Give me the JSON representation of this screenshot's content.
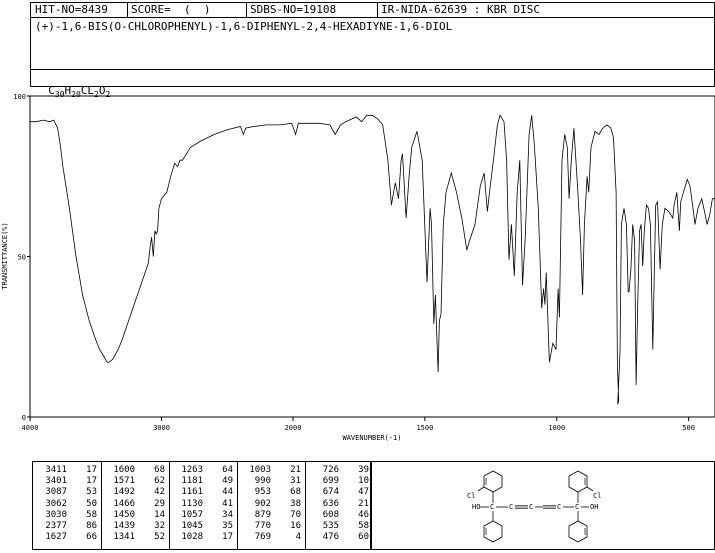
{
  "header": {
    "hit": "HIT-NO=8439",
    "score": "SCORE=  (  )",
    "sdbs": "SDBS-NO=19108",
    "ir": "IR-NIDA-62639 : KBR DISC",
    "compound": "(+)-1,6-BIS(O-CHLOROPHENYL)-1,6-DIPHENYL-2,4-HEXADIYNE-1,6-DIOL",
    "formula_parts": [
      "C",
      "30",
      "H",
      "20",
      "CL",
      "2",
      "O",
      "2"
    ]
  },
  "chart_data": {
    "type": "line",
    "xlabel": "WAVENUMBER(-1)",
    "ylabel": "TRANSMITTANCE(%)",
    "xlim": [
      4000,
      400
    ],
    "ylim": [
      0,
      100
    ],
    "x_ticks": [
      4000,
      3000,
      2000,
      1500,
      1000,
      500
    ],
    "y_ticks": [
      0,
      50,
      100
    ],
    "grid": false,
    "series": [
      {
        "points": [
          [
            4000,
            92
          ],
          [
            3950,
            92
          ],
          [
            3900,
            92.5
          ],
          [
            3850,
            92
          ],
          [
            3820,
            92.5
          ],
          [
            3790,
            90
          ],
          [
            3770,
            85
          ],
          [
            3750,
            78
          ],
          [
            3700,
            65
          ],
          [
            3650,
            50
          ],
          [
            3600,
            38
          ],
          [
            3550,
            30
          ],
          [
            3500,
            24
          ],
          [
            3470,
            21
          ],
          [
            3440,
            19
          ],
          [
            3420,
            17.5
          ],
          [
            3411,
            17
          ],
          [
            3401,
            17
          ],
          [
            3370,
            18
          ],
          [
            3330,
            21
          ],
          [
            3300,
            24
          ],
          [
            3250,
            30
          ],
          [
            3200,
            36
          ],
          [
            3150,
            42
          ],
          [
            3100,
            48
          ],
          [
            3087,
            53
          ],
          [
            3075,
            56
          ],
          [
            3062,
            50
          ],
          [
            3050,
            58
          ],
          [
            3040,
            57
          ],
          [
            3030,
            58
          ],
          [
            3020,
            65
          ],
          [
            3000,
            68
          ],
          [
            2960,
            70
          ],
          [
            2930,
            75
          ],
          [
            2900,
            79
          ],
          [
            2877,
            78
          ],
          [
            2860,
            80
          ],
          [
            2840,
            80
          ],
          [
            2810,
            82
          ],
          [
            2780,
            84
          ],
          [
            2700,
            86
          ],
          [
            2600,
            88
          ],
          [
            2500,
            89.5
          ],
          [
            2400,
            90.5
          ],
          [
            2377,
            88
          ],
          [
            2360,
            90
          ],
          [
            2300,
            90.5
          ],
          [
            2200,
            91
          ],
          [
            2100,
            91
          ],
          [
            2010,
            91.5
          ],
          [
            1990,
            88
          ],
          [
            1980,
            91.5
          ],
          [
            1900,
            91.5
          ],
          [
            1860,
            91
          ],
          [
            1840,
            88
          ],
          [
            1820,
            91
          ],
          [
            1800,
            92
          ],
          [
            1760,
            93.5
          ],
          [
            1740,
            92
          ],
          [
            1720,
            94
          ],
          [
            1700,
            94
          ],
          [
            1680,
            93
          ],
          [
            1660,
            91
          ],
          [
            1640,
            80
          ],
          [
            1627,
            66
          ],
          [
            1612,
            73
          ],
          [
            1600,
            68
          ],
          [
            1590,
            80
          ],
          [
            1585,
            82
          ],
          [
            1571,
            62
          ],
          [
            1560,
            75
          ],
          [
            1550,
            84
          ],
          [
            1530,
            89
          ],
          [
            1510,
            80
          ],
          [
            1492,
            42
          ],
          [
            1480,
            65
          ],
          [
            1475,
            60
          ],
          [
            1466,
            29
          ],
          [
            1460,
            38
          ],
          [
            1450,
            14
          ],
          [
            1445,
            30
          ],
          [
            1439,
            32
          ],
          [
            1430,
            60
          ],
          [
            1420,
            70
          ],
          [
            1400,
            76
          ],
          [
            1380,
            70
          ],
          [
            1360,
            62
          ],
          [
            1341,
            52
          ],
          [
            1330,
            55
          ],
          [
            1310,
            60
          ],
          [
            1290,
            72
          ],
          [
            1275,
            76
          ],
          [
            1263,
            64
          ],
          [
            1255,
            70
          ],
          [
            1240,
            80
          ],
          [
            1225,
            91
          ],
          [
            1215,
            94
          ],
          [
            1200,
            92
          ],
          [
            1190,
            80
          ],
          [
            1181,
            49
          ],
          [
            1172,
            60
          ],
          [
            1161,
            44
          ],
          [
            1150,
            70
          ],
          [
            1140,
            80
          ],
          [
            1130,
            41
          ],
          [
            1120,
            55
          ],
          [
            1105,
            88
          ],
          [
            1095,
            94
          ],
          [
            1085,
            85
          ],
          [
            1070,
            65
          ],
          [
            1057,
            34
          ],
          [
            1050,
            40
          ],
          [
            1045,
            35
          ],
          [
            1040,
            45
          ],
          [
            1028,
            17
          ],
          [
            1015,
            23
          ],
          [
            1003,
            21
          ],
          [
            995,
            40
          ],
          [
            990,
            31
          ],
          [
            980,
            80
          ],
          [
            970,
            88
          ],
          [
            960,
            84
          ],
          [
            953,
            68
          ],
          [
            945,
            80
          ],
          [
            935,
            90
          ],
          [
            920,
            70
          ],
          [
            910,
            55
          ],
          [
            902,
            38
          ],
          [
            895,
            60
          ],
          [
            885,
            75
          ],
          [
            879,
            70
          ],
          [
            870,
            84
          ],
          [
            855,
            89
          ],
          [
            840,
            88
          ],
          [
            825,
            90
          ],
          [
            810,
            91
          ],
          [
            795,
            90
          ],
          [
            785,
            87
          ],
          [
            775,
            70
          ],
          [
            770,
            16
          ],
          [
            765,
            5
          ],
          [
            769,
            4
          ],
          [
            760,
            20
          ],
          [
            755,
            60
          ],
          [
            745,
            65
          ],
          [
            736,
            60
          ],
          [
            729,
            39
          ],
          [
            726,
            39
          ],
          [
            719,
            46
          ],
          [
            712,
            60
          ],
          [
            705,
            55
          ],
          [
            699,
            10
          ],
          [
            693,
            35
          ],
          [
            686,
            58
          ],
          [
            680,
            60
          ],
          [
            674,
            47
          ],
          [
            668,
            58
          ],
          [
            660,
            66
          ],
          [
            652,
            65
          ],
          [
            645,
            60
          ],
          [
            636,
            21
          ],
          [
            630,
            45
          ],
          [
            625,
            66
          ],
          [
            618,
            67
          ],
          [
            608,
            46
          ],
          [
            600,
            60
          ],
          [
            590,
            65
          ],
          [
            575,
            64
          ],
          [
            560,
            62
          ],
          [
            555,
            66
          ],
          [
            545,
            70
          ],
          [
            535,
            58
          ],
          [
            530,
            67
          ],
          [
            520,
            70
          ],
          [
            505,
            74
          ],
          [
            495,
            72
          ],
          [
            485,
            66
          ],
          [
            476,
            60
          ],
          [
            465,
            65
          ],
          [
            450,
            68
          ],
          [
            440,
            64
          ],
          [
            430,
            60
          ],
          [
            420,
            63
          ],
          [
            410,
            68
          ],
          [
            400,
            68
          ]
        ]
      }
    ],
    "peaks": [
      [
        3411,
        17
      ],
      [
        3401,
        17
      ],
      [
        3087,
        53
      ],
      [
        3062,
        50
      ],
      [
        3030,
        58
      ],
      [
        2377,
        86
      ],
      [
        1627,
        66
      ],
      [
        1600,
        68
      ],
      [
        1571,
        62
      ],
      [
        1492,
        42
      ],
      [
        1466,
        29
      ],
      [
        1450,
        14
      ],
      [
        1439,
        32
      ],
      [
        1341,
        52
      ],
      [
        1263,
        64
      ],
      [
        1181,
        49
      ],
      [
        1161,
        44
      ],
      [
        1130,
        41
      ],
      [
        1057,
        34
      ],
      [
        1045,
        35
      ],
      [
        1028,
        17
      ],
      [
        1003,
        21
      ],
      [
        990,
        31
      ],
      [
        953,
        68
      ],
      [
        902,
        38
      ],
      [
        879,
        70
      ],
      [
        770,
        16
      ],
      [
        769,
        4
      ],
      [
        726,
        39
      ],
      [
        699,
        10
      ],
      [
        674,
        47
      ],
      [
        636,
        21
      ],
      [
        608,
        46
      ],
      [
        535,
        58
      ],
      [
        476,
        60
      ]
    ]
  },
  "structure": {
    "labels": [
      "Cl",
      "HO",
      "C",
      "C",
      "C",
      "C",
      "C",
      "OH",
      "Cl"
    ]
  }
}
